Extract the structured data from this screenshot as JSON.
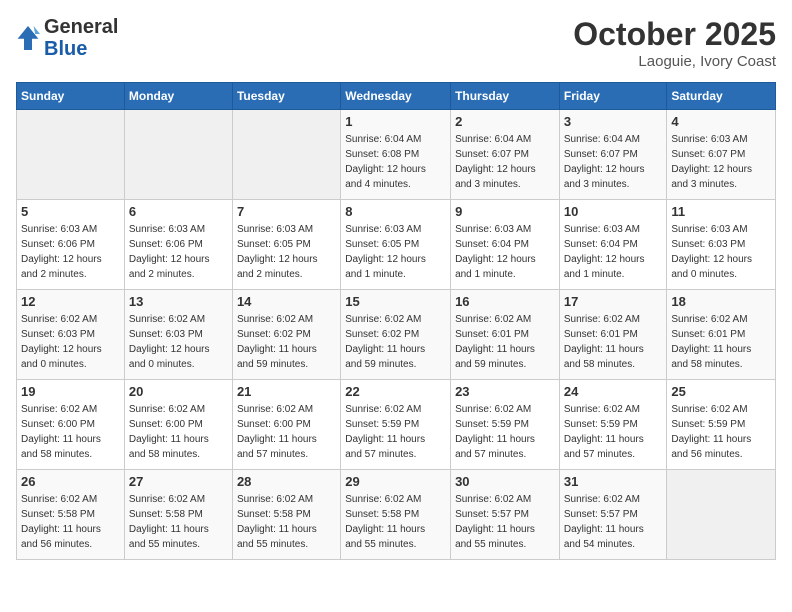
{
  "header": {
    "logo_general": "General",
    "logo_blue": "Blue",
    "month_title": "October 2025",
    "location": "Laoguie, Ivory Coast"
  },
  "days_of_week": [
    "Sunday",
    "Monday",
    "Tuesday",
    "Wednesday",
    "Thursday",
    "Friday",
    "Saturday"
  ],
  "weeks": [
    [
      {
        "day": "",
        "info": ""
      },
      {
        "day": "",
        "info": ""
      },
      {
        "day": "",
        "info": ""
      },
      {
        "day": "1",
        "info": "Sunrise: 6:04 AM\nSunset: 6:08 PM\nDaylight: 12 hours\nand 4 minutes."
      },
      {
        "day": "2",
        "info": "Sunrise: 6:04 AM\nSunset: 6:07 PM\nDaylight: 12 hours\nand 3 minutes."
      },
      {
        "day": "3",
        "info": "Sunrise: 6:04 AM\nSunset: 6:07 PM\nDaylight: 12 hours\nand 3 minutes."
      },
      {
        "day": "4",
        "info": "Sunrise: 6:03 AM\nSunset: 6:07 PM\nDaylight: 12 hours\nand 3 minutes."
      }
    ],
    [
      {
        "day": "5",
        "info": "Sunrise: 6:03 AM\nSunset: 6:06 PM\nDaylight: 12 hours\nand 2 minutes."
      },
      {
        "day": "6",
        "info": "Sunrise: 6:03 AM\nSunset: 6:06 PM\nDaylight: 12 hours\nand 2 minutes."
      },
      {
        "day": "7",
        "info": "Sunrise: 6:03 AM\nSunset: 6:05 PM\nDaylight: 12 hours\nand 2 minutes."
      },
      {
        "day": "8",
        "info": "Sunrise: 6:03 AM\nSunset: 6:05 PM\nDaylight: 12 hours\nand 1 minute."
      },
      {
        "day": "9",
        "info": "Sunrise: 6:03 AM\nSunset: 6:04 PM\nDaylight: 12 hours\nand 1 minute."
      },
      {
        "day": "10",
        "info": "Sunrise: 6:03 AM\nSunset: 6:04 PM\nDaylight: 12 hours\nand 1 minute."
      },
      {
        "day": "11",
        "info": "Sunrise: 6:03 AM\nSunset: 6:03 PM\nDaylight: 12 hours\nand 0 minutes."
      }
    ],
    [
      {
        "day": "12",
        "info": "Sunrise: 6:02 AM\nSunset: 6:03 PM\nDaylight: 12 hours\nand 0 minutes."
      },
      {
        "day": "13",
        "info": "Sunrise: 6:02 AM\nSunset: 6:03 PM\nDaylight: 12 hours\nand 0 minutes."
      },
      {
        "day": "14",
        "info": "Sunrise: 6:02 AM\nSunset: 6:02 PM\nDaylight: 11 hours\nand 59 minutes."
      },
      {
        "day": "15",
        "info": "Sunrise: 6:02 AM\nSunset: 6:02 PM\nDaylight: 11 hours\nand 59 minutes."
      },
      {
        "day": "16",
        "info": "Sunrise: 6:02 AM\nSunset: 6:01 PM\nDaylight: 11 hours\nand 59 minutes."
      },
      {
        "day": "17",
        "info": "Sunrise: 6:02 AM\nSunset: 6:01 PM\nDaylight: 11 hours\nand 58 minutes."
      },
      {
        "day": "18",
        "info": "Sunrise: 6:02 AM\nSunset: 6:01 PM\nDaylight: 11 hours\nand 58 minutes."
      }
    ],
    [
      {
        "day": "19",
        "info": "Sunrise: 6:02 AM\nSunset: 6:00 PM\nDaylight: 11 hours\nand 58 minutes."
      },
      {
        "day": "20",
        "info": "Sunrise: 6:02 AM\nSunset: 6:00 PM\nDaylight: 11 hours\nand 58 minutes."
      },
      {
        "day": "21",
        "info": "Sunrise: 6:02 AM\nSunset: 6:00 PM\nDaylight: 11 hours\nand 57 minutes."
      },
      {
        "day": "22",
        "info": "Sunrise: 6:02 AM\nSunset: 5:59 PM\nDaylight: 11 hours\nand 57 minutes."
      },
      {
        "day": "23",
        "info": "Sunrise: 6:02 AM\nSunset: 5:59 PM\nDaylight: 11 hours\nand 57 minutes."
      },
      {
        "day": "24",
        "info": "Sunrise: 6:02 AM\nSunset: 5:59 PM\nDaylight: 11 hours\nand 57 minutes."
      },
      {
        "day": "25",
        "info": "Sunrise: 6:02 AM\nSunset: 5:59 PM\nDaylight: 11 hours\nand 56 minutes."
      }
    ],
    [
      {
        "day": "26",
        "info": "Sunrise: 6:02 AM\nSunset: 5:58 PM\nDaylight: 11 hours\nand 56 minutes."
      },
      {
        "day": "27",
        "info": "Sunrise: 6:02 AM\nSunset: 5:58 PM\nDaylight: 11 hours\nand 55 minutes."
      },
      {
        "day": "28",
        "info": "Sunrise: 6:02 AM\nSunset: 5:58 PM\nDaylight: 11 hours\nand 55 minutes."
      },
      {
        "day": "29",
        "info": "Sunrise: 6:02 AM\nSunset: 5:58 PM\nDaylight: 11 hours\nand 55 minutes."
      },
      {
        "day": "30",
        "info": "Sunrise: 6:02 AM\nSunset: 5:57 PM\nDaylight: 11 hours\nand 55 minutes."
      },
      {
        "day": "31",
        "info": "Sunrise: 6:02 AM\nSunset: 5:57 PM\nDaylight: 11 hours\nand 54 minutes."
      },
      {
        "day": "",
        "info": ""
      }
    ]
  ]
}
